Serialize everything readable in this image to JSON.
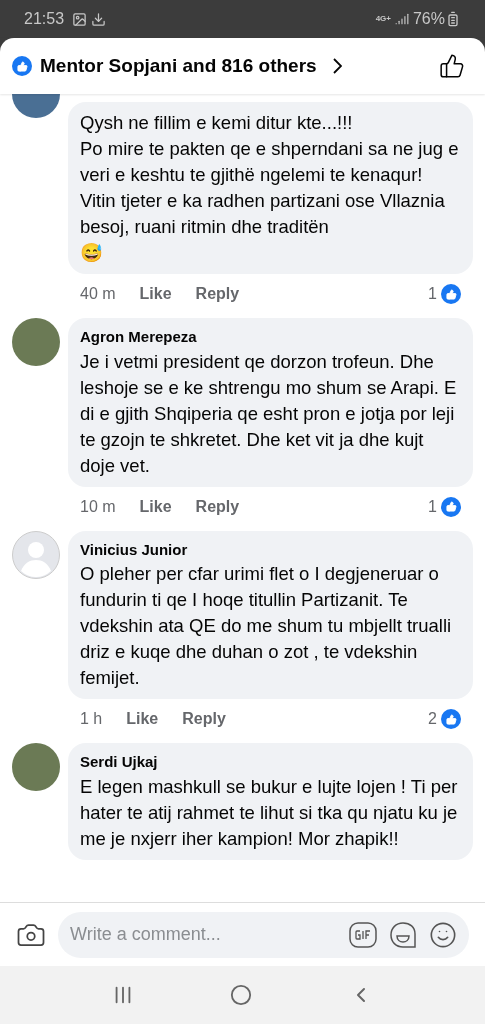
{
  "status_bar": {
    "time": "21:53",
    "network": "4G+",
    "battery": "76%"
  },
  "header": {
    "title": "Mentor Sopjani and 816 others"
  },
  "comments": [
    {
      "paragraphs": [
        "Qysh ne fillim e kemi ditur kte...!!!",
        "Po mire te pakten qe e shperndani sa ne jug e veri e keshtu te gjithë ngelemi te kenaqur!",
        "Vitin tjeter e ka radhen partizani ose Vllaznia besoj, ruani ritmin dhe traditën",
        "😅"
      ],
      "time": "40 m",
      "like": "Like",
      "reply": "Reply",
      "reactions": "1",
      "kind": "badge"
    },
    {
      "author": "Agron Merepeza",
      "paragraphs": [
        "Je i vetmi president qe dorzon trofeun. Dhe leshoje se e ke shtrengu mo shum se Arapi. E di e gjith Shqiperia qe esht pron e jotja por leji te gzojn te shkretet. Dhe ket vit ja dhe kujt doje vet."
      ],
      "time": "10 m",
      "like": "Like",
      "reply": "Reply",
      "reactions": "1",
      "kind": "photo"
    },
    {
      "author": "Vinicius Junior",
      "paragraphs": [
        "O pleher per cfar urimi flet o I degjeneruar o fundurin ti qe I hoqe titullin Partizanit. Te vdekshin ata QE do me shum tu mbjellt trualli driz e kuqe dhe duhan o zot , te vdekshin femijet."
      ],
      "time": "1 h",
      "like": "Like",
      "reply": "Reply",
      "reactions": "2",
      "kind": "silhouette"
    },
    {
      "author": "Serdi Ujkaj",
      "paragraphs": [
        "E legen mashkull  se bukur e lujte lojen ! Ti per hater te atij rahmet te lihut si tka qu njatu ku je me  je nxjerr iher kampion! Mor zhapik!!"
      ],
      "kind": "photo"
    }
  ],
  "composer": {
    "placeholder": "Write a comment..."
  }
}
